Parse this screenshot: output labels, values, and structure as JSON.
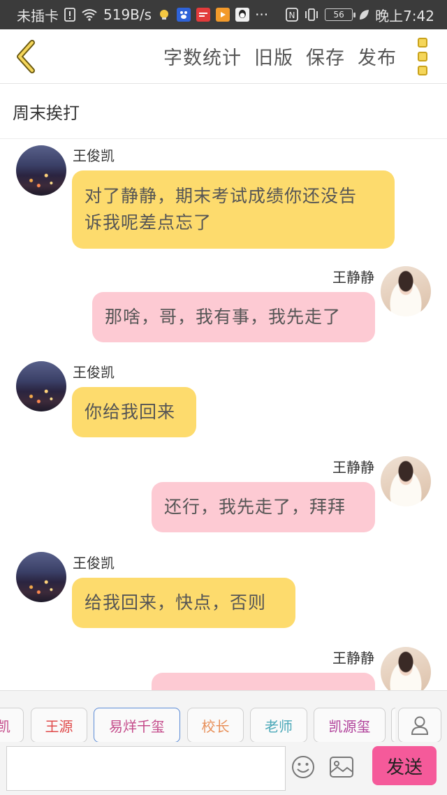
{
  "status_bar": {
    "carrier": "未插卡",
    "speed": "519B/s",
    "more": "···",
    "nfc": "N",
    "battery": "56",
    "time": "晚上7:42",
    "app_icons": [
      "bulb-icon",
      "baidu-icon",
      "news-icon",
      "video-icon",
      "qq-icon"
    ]
  },
  "header": {
    "actions": [
      "字数统计",
      "旧版",
      "保存",
      "发布"
    ],
    "accent_color": "#f5d65a"
  },
  "doc_title": "周末挨打",
  "messages": [
    {
      "side": "left",
      "name": "王俊凯",
      "lines": [
        "对了静静，期末考试成绩你还没告",
        "诉我呢差点忘了"
      ]
    },
    {
      "side": "right",
      "name": "王静静",
      "lines": [
        "那啥，哥，我有事，我先走了"
      ]
    },
    {
      "side": "left",
      "name": "王俊凯",
      "lines": [
        "你给我回来"
      ]
    },
    {
      "side": "right",
      "name": "王静静",
      "lines": [
        "还行，我先走了，拜拜"
      ]
    },
    {
      "side": "left",
      "name": "王俊凯",
      "lines": [
        "给我回来，快点，否则"
      ]
    },
    {
      "side": "right",
      "name": "王静静",
      "lines": [
        ""
      ]
    }
  ],
  "roles": [
    {
      "label": "凯",
      "color": "#c44a8a"
    },
    {
      "label": "王源",
      "color": "#e04a4a"
    },
    {
      "label": "易烊千玺",
      "color": "#c44a8a",
      "selected": true
    },
    {
      "label": "校长",
      "color": "#e8905a"
    },
    {
      "label": "老师",
      "color": "#4aa8b8"
    },
    {
      "label": "凯源玺",
      "color": "#b0409a"
    },
    {
      "label": "",
      "color": "#333333"
    }
  ],
  "input": {
    "placeholder": "",
    "send_label": "发送"
  },
  "colors": {
    "left_bubble": "#fddb6d",
    "right_bubble": "#fdcad3",
    "send": "#f55a9a"
  }
}
